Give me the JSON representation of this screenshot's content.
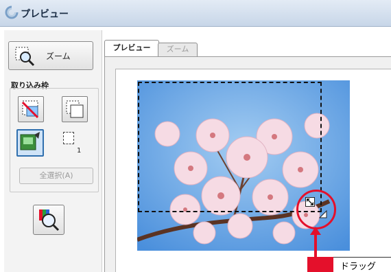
{
  "window": {
    "title": "プレビュー",
    "title_icon": "scanner-app-icon"
  },
  "left_panel": {
    "zoom_button_label": "ズーム",
    "group_label": "取り込み枠",
    "marquee_count": "1",
    "select_all_label": "全選択(A)"
  },
  "tabs": [
    {
      "label": "プレビュー",
      "active": true
    },
    {
      "label": "ズーム",
      "active": false
    }
  ],
  "callout": {
    "label": "ドラッグ",
    "color": "#e4102b"
  },
  "colors": {
    "accent": "#e4102b",
    "titlebar": "#c7d6e8"
  }
}
